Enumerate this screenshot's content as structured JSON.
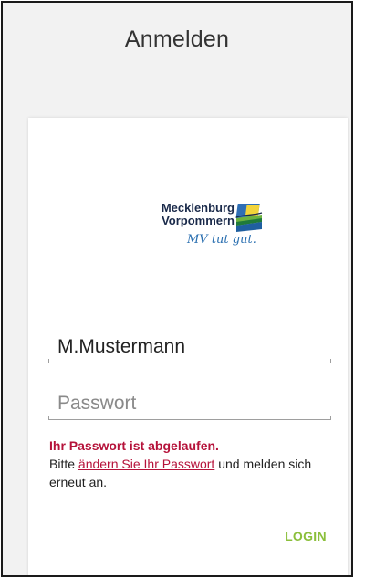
{
  "header": {
    "title": "Anmelden"
  },
  "logo": {
    "line1": "Mecklenburg",
    "line2": "Vorpommern",
    "slogan": "MV tut gut."
  },
  "form": {
    "username_value": "M.Mustermann",
    "password_placeholder": "Passwort"
  },
  "error": {
    "title": "Ihr Passwort ist abgelaufen.",
    "text_before": "Bitte ",
    "link_text": "ändern Sie Ihr Passwort",
    "text_after": " und melden sich erneut an."
  },
  "actions": {
    "login_label": "LOGIN"
  },
  "colors": {
    "background": "#f2f2f2",
    "card": "#ffffff",
    "error": "#b5123a",
    "login": "#8bbf3b",
    "slogan": "#2a6fb0"
  }
}
